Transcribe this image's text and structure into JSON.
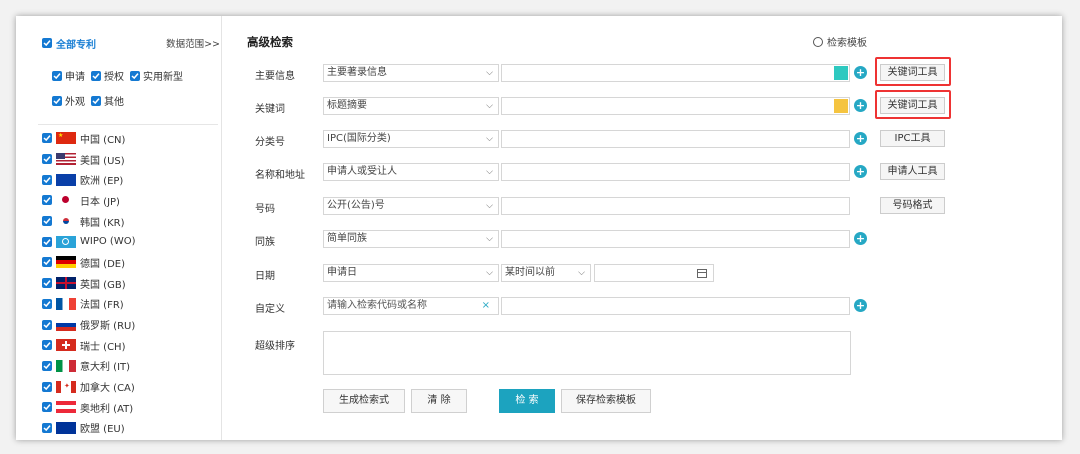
{
  "sidebar": {
    "all_label": "全部专利",
    "range_label": "数据范围>>",
    "types_row1": [
      "申请",
      "授权",
      "实用新型"
    ],
    "types_row2": [
      "外观",
      "其他"
    ],
    "countries": [
      {
        "name": "中国 (CN)",
        "flag": "cn"
      },
      {
        "name": "美国 (US)",
        "flag": "us"
      },
      {
        "name": "欧洲 (EP)",
        "flag": "ep"
      },
      {
        "name": "日本 (JP)",
        "flag": "jp"
      },
      {
        "name": "韩国 (KR)",
        "flag": "kr"
      },
      {
        "name": "WIPO (WO)",
        "flag": "wo"
      },
      {
        "name": "德国 (DE)",
        "flag": "de"
      },
      {
        "name": "英国 (GB)",
        "flag": "gb"
      },
      {
        "name": "法国 (FR)",
        "flag": "fr"
      },
      {
        "name": "俄罗斯 (RU)",
        "flag": "ru"
      },
      {
        "name": "瑞士 (CH)",
        "flag": "ch"
      },
      {
        "name": "意大利 (IT)",
        "flag": "it"
      },
      {
        "name": "加拿大 (CA)",
        "flag": "ca"
      },
      {
        "name": "奥地利 (AT)",
        "flag": "at"
      },
      {
        "name": "欧盟 (EU)",
        "flag": "eu"
      }
    ]
  },
  "main": {
    "title": "高级检索",
    "template_label": "检索模板",
    "rows": {
      "primary": {
        "label": "主要信息",
        "select": "主要著录信息",
        "tool": "关键词工具"
      },
      "keyword": {
        "label": "关键词",
        "select": "标题摘要",
        "tool": "关键词工具"
      },
      "class": {
        "label": "分类号",
        "select": "IPC(国际分类)",
        "tool": "IPC工具"
      },
      "name": {
        "label": "名称和地址",
        "select": "申请人或受让人",
        "tool": "申请人工具"
      },
      "number": {
        "label": "号码",
        "select": "公开(公告)号",
        "tool": "号码格式"
      },
      "family": {
        "label": "同族",
        "select": "简单同族"
      },
      "date": {
        "label": "日期",
        "select": "申请日",
        "range_select": "某时间以前"
      },
      "custom": {
        "label": "自定义",
        "placeholder": "请输入检索代码或名称",
        "clear": "×"
      },
      "sort": {
        "label": "超级排序"
      }
    },
    "buttons": {
      "generate": "生成检索式",
      "clear": "清 除",
      "search": "检 索",
      "save_template": "保存检索模板"
    }
  },
  "colors": {
    "accent": "#1ca3bf",
    "checkbox": "#1479d2",
    "highlight": "#e33333",
    "swatch_primary": "#2ec9c0",
    "swatch_keyword": "#f5c440"
  }
}
